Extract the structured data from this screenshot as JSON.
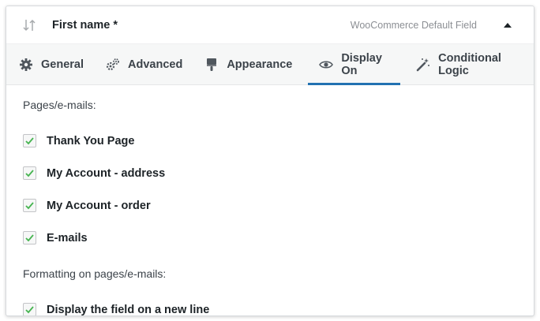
{
  "field": {
    "title": "First name *",
    "meta": "WooCommerce Default Field"
  },
  "tabs": [
    {
      "label": "General",
      "icon": "gear-icon",
      "active": false
    },
    {
      "label": "Advanced",
      "icon": "gears-icon",
      "active": false
    },
    {
      "label": "Appearance",
      "icon": "paint-brush-icon",
      "active": false
    },
    {
      "label": "Display On",
      "icon": "eye-icon",
      "active": true
    },
    {
      "label": "Conditional Logic",
      "icon": "magic-wand-icon",
      "active": false
    }
  ],
  "sections": [
    {
      "label": "Pages/e-mails:",
      "items": [
        {
          "label": "Thank You Page",
          "checked": true
        },
        {
          "label": "My Account - address",
          "checked": true
        },
        {
          "label": "My Account - order",
          "checked": true
        },
        {
          "label": "E-mails",
          "checked": true
        }
      ]
    },
    {
      "label": "Formatting on pages/e-mails:",
      "items": [
        {
          "label": "Display the field on a new line",
          "checked": true
        }
      ]
    }
  ],
  "colors": {
    "accent": "#2271b1",
    "check": "#46b450",
    "tab_bar": "#f6f7f7"
  }
}
